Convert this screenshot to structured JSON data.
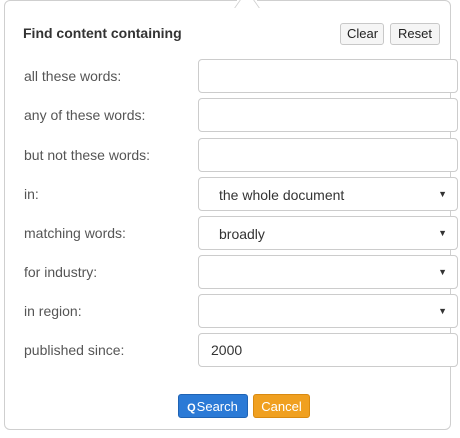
{
  "form": {
    "title": "Find content containing",
    "clear_label": "Clear",
    "reset_label": "Reset",
    "fields": [
      {
        "label": "all these words:",
        "value": ""
      },
      {
        "label": "any of these words:",
        "value": ""
      },
      {
        "label": "but not these words:",
        "value": ""
      },
      {
        "label": "in:",
        "value": "the whole document"
      },
      {
        "label": "matching words:",
        "value": "broadly"
      },
      {
        "label": "for industry:",
        "value": ""
      },
      {
        "label": "in region:",
        "value": ""
      },
      {
        "label": "published since:",
        "value": "2000"
      }
    ],
    "search_label": "Search",
    "cancel_label": "Cancel"
  },
  "icons": {
    "search": "search-icon",
    "dropdown": "chevron-down-icon"
  },
  "colors": {
    "search_button": "#2b7ad6",
    "cancel_button": "#f0a020",
    "border": "#cccccc"
  }
}
